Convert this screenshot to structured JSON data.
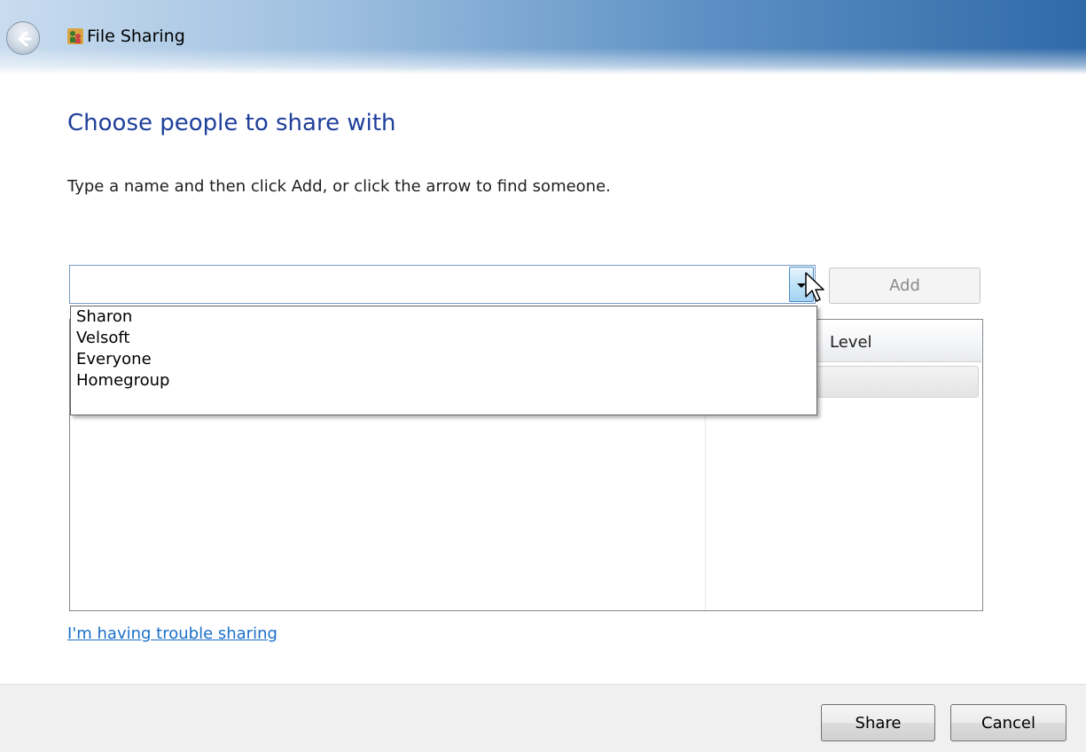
{
  "window": {
    "title": "File Sharing",
    "app_icon": "people-share-icon",
    "back_icon": "back-arrow-icon"
  },
  "main": {
    "heading": "Choose people to share with",
    "instruction": "Type a name and then click Add, or click the arrow to find someone.",
    "name_input": {
      "value": "",
      "placeholder": ""
    },
    "add_label": "Add",
    "dropdown_options": [
      "Sharon",
      "Velsoft",
      "Everyone",
      "Homegroup"
    ],
    "column_header_partial": "Level",
    "trouble_link": "I'm having trouble sharing"
  },
  "footer": {
    "share_label": "Share",
    "cancel_label": "Cancel"
  },
  "colors": {
    "heading": "#1e3f9a",
    "link": "#1a6fc9",
    "titlebar_dark": "#2f6aa8"
  }
}
